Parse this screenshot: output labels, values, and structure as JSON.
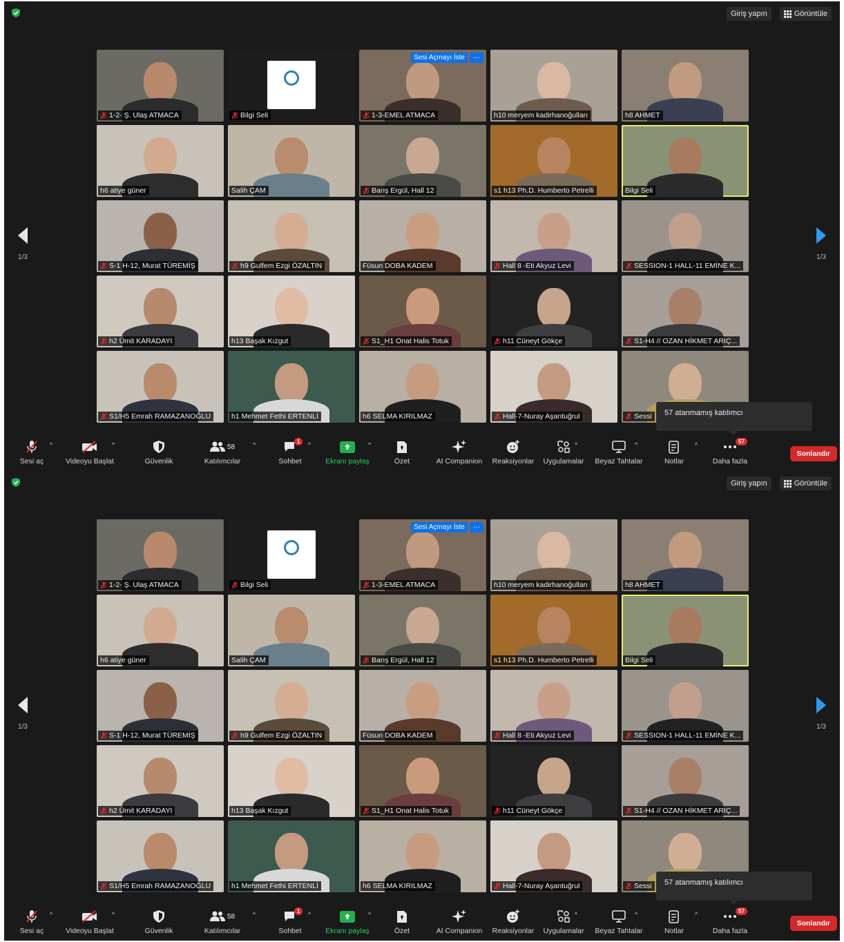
{
  "topbar": {
    "sign_in": "Giriş yapın",
    "view": "Görüntüle"
  },
  "pager": {
    "left_page": "1/3",
    "right_page": "1/3"
  },
  "ask_unmute": {
    "label": "Sesi Açmayı İste",
    "more": "···"
  },
  "participants": [
    {
      "name": "1-2- Ş. Ulaş ATMACA",
      "muted": true,
      "bg": "#6b6b63",
      "skin": "#b88a6b",
      "shirt": "#2c2c2c"
    },
    {
      "name": "Bilgi Seli",
      "muted": true,
      "bg": "#1d1d1d",
      "logo": true
    },
    {
      "name": "1-3-EMEL ATMACA",
      "muted": true,
      "bg": "#7a6b5c",
      "skin": "#c09a80",
      "shirt": "#3a2f2a"
    },
    {
      "name": "h10 meryem kadirhanoğulları",
      "muted": false,
      "bg": "#a9a196",
      "skin": "#d9b9a3",
      "shirt": "#6d5c4e"
    },
    {
      "name": "h8 AHMET",
      "muted": false,
      "bg": "#8a7f72",
      "skin": "#c19a80",
      "shirt": "#3a3f52"
    },
    {
      "name": "h6 atiye güner",
      "muted": false,
      "bg": "#c9c2b8",
      "skin": "#d2aa90",
      "shirt": "#2d2d2d"
    },
    {
      "name": "Salih ÇAM",
      "muted": false,
      "bg": "#bfb6a8",
      "skin": "#b88c6d",
      "shirt": "#6b7f8a"
    },
    {
      "name": "Barış Ergül, Hall 12",
      "muted": true,
      "bg": "#7a7567",
      "skin": "#c8a890",
      "shirt": "#4a4a46"
    },
    {
      "name": "s1 h13 Ph.D.  Humberto Petrelli",
      "muted": false,
      "bg": "#a26b2a",
      "skin": "#b88360",
      "shirt": "#7a6a5a"
    },
    {
      "name": "Bilgi Seli",
      "muted": false,
      "bg": "#8a9276",
      "skin": "#a87a5e",
      "shirt": "#2b2b2b",
      "active": true
    },
    {
      "name": "S-1 H-12, Murat TÜREMİŞ",
      "muted": true,
      "bg": "#b9b4ad",
      "skin": "#8a6148",
      "shirt": "#2d2f36"
    },
    {
      "name": "h9 Gulfem Ezgi ÖZALTIN",
      "muted": true,
      "bg": "#c7c1b4",
      "skin": "#d4ad92",
      "shirt": "#5b4b3b"
    },
    {
      "name": "Füsun DOBA KADEM",
      "muted": false,
      "bg": "#b8b0a6",
      "skin": "#c89d80",
      "shirt": "#5a3a2a"
    },
    {
      "name": "Hall 8 -Eti Akyuz Levi",
      "muted": true,
      "bg": "#c2b8ac",
      "skin": "#c8a08a",
      "shirt": "#6d5a7a"
    },
    {
      "name": "SESSION-1 HALL-11 EMİNE K...",
      "muted": true,
      "bg": "#9a948c",
      "skin": "#c0a08c",
      "shirt": "#222222"
    },
    {
      "name": "h2 Ümit KARADAYI",
      "muted": true,
      "bg": "#cfc9c0",
      "skin": "#b78a6d",
      "shirt": "#3b3b40"
    },
    {
      "name": "h13 Başak Kızgut",
      "muted": false,
      "bg": "#d8d2cb",
      "skin": "#e0bca5",
      "shirt": "#2a2a2a"
    },
    {
      "name": "S1_H1 Onat Halis Totuk",
      "muted": true,
      "bg": "#6b5a48",
      "skin": "#c99a7c",
      "shirt": "#6a3e3e"
    },
    {
      "name": "h11 Cüneyt Gökçe",
      "muted": true,
      "bg": "#232323",
      "skin": "#c7a48c",
      "shirt": "#3e3e40"
    },
    {
      "name": "S1-H4 // OZAN HİKMET ARIÇ...",
      "muted": true,
      "bg": "#a79f97",
      "skin": "#a88068",
      "shirt": "#3b3b3b"
    },
    {
      "name": "S1/H5 Emrah RAMAZANOĞLU",
      "muted": true,
      "bg": "#c8c3ba",
      "skin": "#b98b6a",
      "shirt": "#2f3340"
    },
    {
      "name": "h1 Mehmet Fethi ERTENLİ",
      "muted": false,
      "bg": "#3c5a4e",
      "skin": "#c49a80",
      "shirt": "#d8d8d8"
    },
    {
      "name": "h6 SELMA KIRILMAZ",
      "muted": false,
      "bg": "#b8b0a2",
      "skin": "#c79b80",
      "shirt": "#1f1f1f"
    },
    {
      "name": "Hall-7-Nuray Aşantuğrul",
      "muted": true,
      "bg": "#d6d2ca",
      "skin": "#c49a82",
      "shirt": "#3a2a2a"
    },
    {
      "name": "Sessi",
      "muted": true,
      "bg": "#8f887c",
      "skin": "#d0ae94",
      "shirt": "#b3a05a"
    }
  ],
  "tooltip": {
    "text": "57 atanmamış katılımcı"
  },
  "toolbar": {
    "audio": "Sesi aç",
    "video": "Videoyu Başlat",
    "security": "Güvenlik",
    "participants": "Katılımcılar",
    "participants_count": "58",
    "chat": "Sohbet",
    "chat_badge": "1",
    "share": "Ekranı paylaş",
    "summary": "Özet",
    "ai": "AI Companion",
    "reactions": "Reaksiyonlar",
    "apps": "Uygulamalar",
    "whiteboards": "Beyaz Tahtalar",
    "notes": "Notlar",
    "more": "Daha fazla",
    "more_badge": "57",
    "end": "Sonlandır"
  },
  "colors": {
    "accent": "#0e71eb",
    "share_green": "#23b14d",
    "end_red": "#d62828",
    "active_speaker": "#e4ef6a"
  }
}
